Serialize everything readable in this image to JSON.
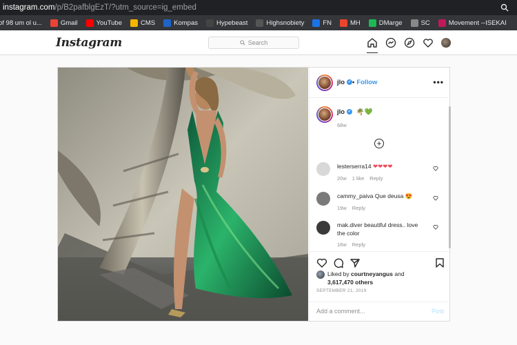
{
  "browser": {
    "url_host": "instagram.com",
    "url_path": "/p/B2pafblgEzT/?utm_source=ig_embed",
    "bookmarks": [
      {
        "label": "of 98 um ol u...",
        "icon": "blank",
        "color": "#35363a"
      },
      {
        "label": "Gmail",
        "icon": "gmail-icon",
        "color": "#ea4335"
      },
      {
        "label": "YouTube",
        "icon": "youtube-icon",
        "color": "#ff0000"
      },
      {
        "label": "CMS",
        "icon": "cms-icon",
        "color": "#f4b400"
      },
      {
        "label": "Kompas",
        "icon": "kompas-icon",
        "color": "#1e64c8"
      },
      {
        "label": "Hypebeast",
        "icon": "hypebeast-icon",
        "color": "#444444"
      },
      {
        "label": "Highsnobiety",
        "icon": "highsnobiety-icon",
        "color": "#555555"
      },
      {
        "label": "FN",
        "icon": "fn-icon",
        "color": "#1a73e8"
      },
      {
        "label": "MH",
        "icon": "mh-icon",
        "color": "#e8452c"
      },
      {
        "label": "DMarge",
        "icon": "dmarge-icon",
        "color": "#1db954"
      },
      {
        "label": "SC",
        "icon": "sc-icon",
        "color": "#888888"
      },
      {
        "label": "Movement --ISEKAI",
        "icon": "isekai-icon",
        "color": "#c2185b"
      }
    ]
  },
  "header": {
    "logo": "Instagram",
    "search_placeholder": "Search"
  },
  "post": {
    "username": "jlo",
    "follow_label": "Follow",
    "more_label": "•••",
    "caption_emoji": "🌴💚",
    "caption_time": "68w",
    "comments": [
      {
        "user": "lesterserra14",
        "text": "❤❤❤❤",
        "time": "20w",
        "likes": "1 like",
        "reply": "Reply",
        "avatar_color": "#d8d8d8"
      },
      {
        "user": "cammy_paiva",
        "text": "Que deusa 😍",
        "time": "19w",
        "likes": "",
        "reply": "Reply",
        "avatar_color": "#7a7a7a"
      },
      {
        "user": "mak.diver",
        "text": "beautiful dress.. love the color",
        "time": "16w",
        "likes": "",
        "reply": "Reply",
        "avatar_color": "#3a3a3a"
      }
    ],
    "liked_by_prefix": "Liked by",
    "liked_by_user": "courtneyangus",
    "liked_and": "and",
    "likes_count": "3,617,470 others",
    "date": "SEPTEMBER 21, 2019",
    "add_comment_placeholder": "Add a comment...",
    "post_button": "Post"
  }
}
